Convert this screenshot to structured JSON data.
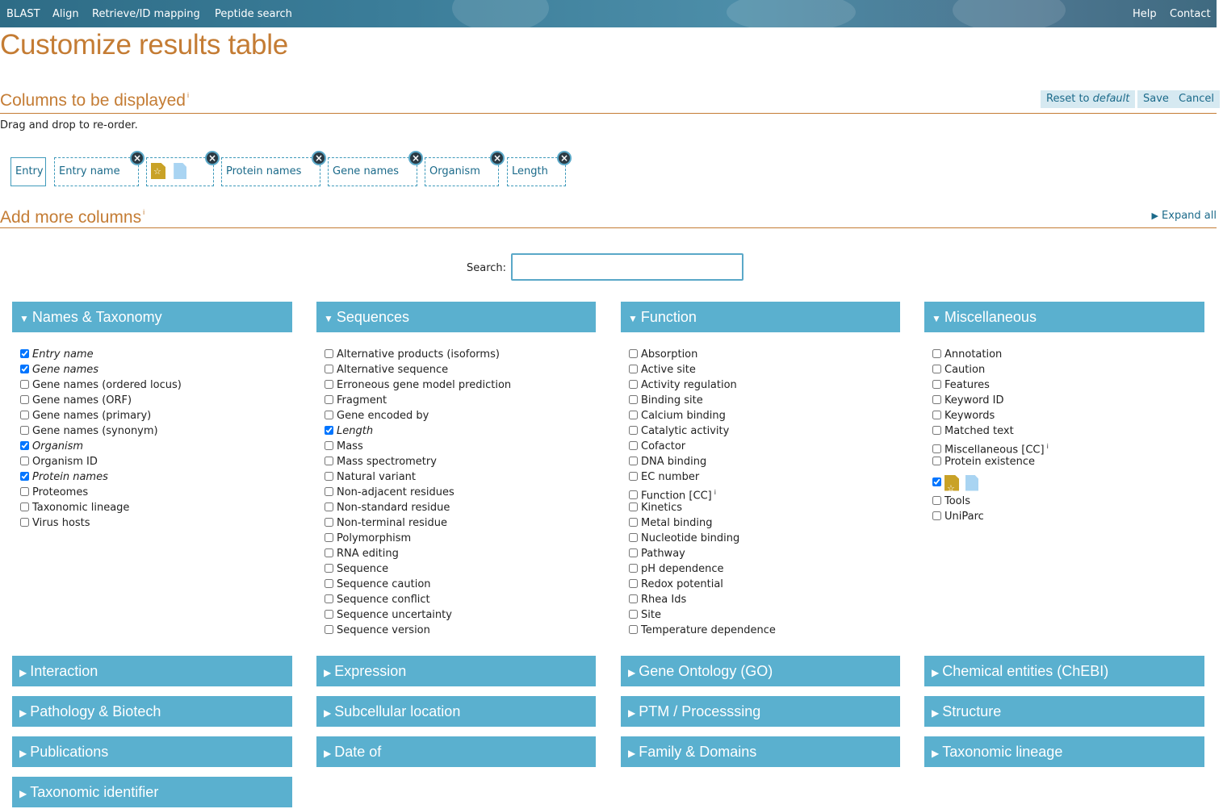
{
  "nav": {
    "left": [
      "BLAST",
      "Align",
      "Retrieve/ID mapping",
      "Peptide search"
    ],
    "right": [
      "Help",
      "Contact"
    ]
  },
  "page_title": "Customize results table",
  "columns_section": {
    "title": "Columns to be displayed",
    "info": "i",
    "reset_prefix": "Reset to ",
    "reset_emph": "default",
    "save": "Save",
    "cancel": "Cancel",
    "hint": "Drag and drop to re-order.",
    "chips": [
      "Entry",
      "Entry name",
      "",
      "Protein names",
      "Gene names",
      "Organism",
      "Length"
    ]
  },
  "add_section": {
    "title": "Add more columns",
    "info": "i",
    "expand_all": "Expand all",
    "search_label": "Search:",
    "search_value": ""
  },
  "open_categories": [
    {
      "title": "Names & Taxonomy",
      "options": [
        {
          "label": "Entry name",
          "checked": true
        },
        {
          "label": "Gene names",
          "checked": true
        },
        {
          "label": "Gene names (ordered locus)",
          "checked": false
        },
        {
          "label": "Gene names (ORF)",
          "checked": false
        },
        {
          "label": "Gene names (primary)",
          "checked": false
        },
        {
          "label": "Gene names (synonym)",
          "checked": false
        },
        {
          "label": "Organism",
          "checked": true
        },
        {
          "label": "Organism ID",
          "checked": false
        },
        {
          "label": "Protein names",
          "checked": true
        },
        {
          "label": "Proteomes",
          "checked": false
        },
        {
          "label": "Taxonomic lineage",
          "checked": false
        },
        {
          "label": "Virus hosts",
          "checked": false
        }
      ]
    },
    {
      "title": "Sequences",
      "options": [
        {
          "label": "Alternative products (isoforms)",
          "checked": false
        },
        {
          "label": "Alternative sequence",
          "checked": false
        },
        {
          "label": "Erroneous gene model prediction",
          "checked": false
        },
        {
          "label": "Fragment",
          "checked": false
        },
        {
          "label": "Gene encoded by",
          "checked": false
        },
        {
          "label": "Length",
          "checked": true
        },
        {
          "label": "Mass",
          "checked": false
        },
        {
          "label": "Mass spectrometry",
          "checked": false
        },
        {
          "label": "Natural variant",
          "checked": false
        },
        {
          "label": "Non-adjacent residues",
          "checked": false
        },
        {
          "label": "Non-standard residue",
          "checked": false
        },
        {
          "label": "Non-terminal residue",
          "checked": false
        },
        {
          "label": "Polymorphism",
          "checked": false
        },
        {
          "label": "RNA editing",
          "checked": false
        },
        {
          "label": "Sequence",
          "checked": false
        },
        {
          "label": "Sequence caution",
          "checked": false
        },
        {
          "label": "Sequence conflict",
          "checked": false
        },
        {
          "label": "Sequence uncertainty",
          "checked": false
        },
        {
          "label": "Sequence version",
          "checked": false
        }
      ]
    },
    {
      "title": "Function",
      "options": [
        {
          "label": "Absorption",
          "checked": false
        },
        {
          "label": "Active site",
          "checked": false
        },
        {
          "label": "Activity regulation",
          "checked": false
        },
        {
          "label": "Binding site",
          "checked": false
        },
        {
          "label": "Calcium binding",
          "checked": false
        },
        {
          "label": "Catalytic activity",
          "checked": false
        },
        {
          "label": "Cofactor",
          "checked": false
        },
        {
          "label": "DNA binding",
          "checked": false
        },
        {
          "label": "EC number",
          "checked": false
        },
        {
          "label": "Function [CC]",
          "checked": false,
          "info": "i"
        },
        {
          "label": "Kinetics",
          "checked": false
        },
        {
          "label": "Metal binding",
          "checked": false
        },
        {
          "label": "Nucleotide binding",
          "checked": false
        },
        {
          "label": "Pathway",
          "checked": false
        },
        {
          "label": "pH dependence",
          "checked": false
        },
        {
          "label": "Redox potential",
          "checked": false
        },
        {
          "label": "Rhea Ids",
          "checked": false
        },
        {
          "label": "Site",
          "checked": false
        },
        {
          "label": "Temperature dependence",
          "checked": false
        }
      ]
    },
    {
      "title": "Miscellaneous",
      "options": [
        {
          "label": "Annotation",
          "checked": false
        },
        {
          "label": "Caution",
          "checked": false
        },
        {
          "label": "Features",
          "checked": false
        },
        {
          "label": "Keyword ID",
          "checked": false
        },
        {
          "label": "Keywords",
          "checked": false
        },
        {
          "label": "Matched text",
          "checked": false
        },
        {
          "label": "Miscellaneous [CC]",
          "checked": false,
          "info": "i"
        },
        {
          "label": "Protein existence",
          "checked": false
        },
        {
          "label": "",
          "checked": true,
          "icons": [
            "reviewed-status-icon",
            "unreviewed-status-icon"
          ]
        },
        {
          "label": "Tools",
          "checked": false
        },
        {
          "label": "UniParc",
          "checked": false
        }
      ]
    }
  ],
  "collapsed_categories": [
    "Interaction",
    "Expression",
    "Gene Ontology (GO)",
    "Chemical entities (ChEBI)",
    "Pathology & Biotech",
    "Subcellular location",
    "PTM / Processsing",
    "Structure",
    "Publications",
    "Date of",
    "Family & Domains",
    "Taxonomic lineage",
    "Taxonomic identifier"
  ],
  "colors": {
    "accent_orange": "#c47c34",
    "category_blue": "#5ab0cf",
    "link_blue": "#1b6a8a"
  }
}
